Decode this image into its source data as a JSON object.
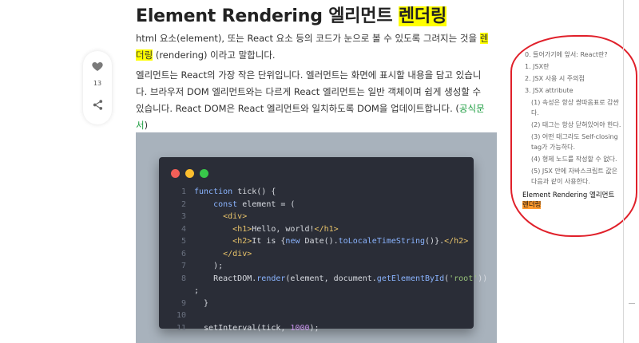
{
  "title": {
    "before": "Element Rendering 엘리먼트 ",
    "highlight": "렌더링"
  },
  "para1": {
    "before": "html 요소(element), 또는 React 요소 등의 코드가 눈으로 볼 수 있도록 그려지는 것을 ",
    "highlight": "렌더링",
    "after": " (rendering) 이라고 말합니다."
  },
  "para2": {
    "text": "엘리먼트는 React의 가장 작은 단위입니다. 엘러먼트는 화면에 표시할 내용을 담고 있습니다. 브라우저 DOM 엘리먼트와는 다르게 React 엘리먼트는 일반 객체이며 쉽게 생성할 수 있습니다. React DOM은 React 엘리먼트와 일치하도록 DOM을 업데이트합니다. (",
    "link": "공식문서",
    "close": ")"
  },
  "sidebar": {
    "like_count": "13",
    "heart_icon": "heart-icon",
    "share_icon": "share-icon"
  },
  "code": {
    "lines": [
      {
        "n": "1",
        "t": "function tick() {"
      },
      {
        "n": "2",
        "t": "    const element = ("
      },
      {
        "n": "3",
        "t": "      <div>"
      },
      {
        "n": "4",
        "t": "        <h1>Hello, world!</h1>"
      },
      {
        "n": "5",
        "t": "        <h2>It is {new Date().toLocaleTimeString()}.</h2>"
      },
      {
        "n": "6",
        "t": "      </div>"
      },
      {
        "n": "7",
        "t": "    );"
      },
      {
        "n": "8",
        "t": "    ReactDOM.render(element, document.getElementById('root'))"
      },
      {
        "n": "",
        "t": ";"
      },
      {
        "n": "9",
        "t": "  }"
      },
      {
        "n": "10",
        "t": ""
      },
      {
        "n": "11",
        "t": "  setInterval(tick, 1000);"
      }
    ]
  },
  "toc": {
    "items": [
      {
        "level": 1,
        "label": "0. 들어가기에 앞서: React란?"
      },
      {
        "level": 1,
        "label": "1. JSX란"
      },
      {
        "level": 1,
        "label": "2. JSX 사용 시 주의점"
      },
      {
        "level": 1,
        "label": "3. JSX attribute"
      },
      {
        "level": 2,
        "label": "(1) 속성은 항상 쌍따옴표로 감싼다."
      },
      {
        "level": 2,
        "label": "(2) 태그는 항상 닫혀있어야 한다."
      },
      {
        "level": 2,
        "label": "(3) 어떤 태그라도 Self-closing tag가 가능하다."
      },
      {
        "level": 2,
        "label": "(4) 형제 노드를 작성할 수 없다."
      },
      {
        "level": 2,
        "label": "(5) JSX 안에 자바스크립트 값은 다음과 같이 사용한다."
      }
    ],
    "current": {
      "before": "Element Rendering 엘리먼트 ",
      "highlight": "렌더링"
    }
  },
  "colors": {
    "highlight": "#ffff00",
    "toc_highlight": "#ff9a2e",
    "annotation": "#e0202a",
    "link": "#1a9c3e"
  }
}
